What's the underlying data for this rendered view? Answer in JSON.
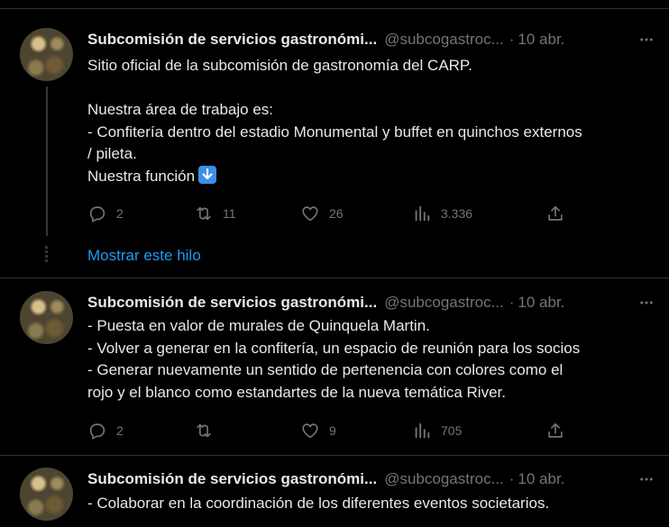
{
  "tweets": [
    {
      "author_name": "Subcomisión de servicios gastronómi...",
      "handle": "@subcogastroc...",
      "separator": "·",
      "time": "10 abr.",
      "lines": [
        "Sitio oficial de la subcomisión de gastronomía del CARP.",
        "",
        "Nuestra área de trabajo es:",
        "- Confitería dentro del estadio Monumental y buffet en quinchos externos",
        "/ pileta.",
        "Nuestra función"
      ],
      "emoji": "arrow-down-emoji",
      "replies": "2",
      "retweets": "11",
      "likes": "26",
      "views": "3.336"
    },
    {
      "author_name": "Subcomisión de servicios gastronómi...",
      "handle": "@subcogastroc...",
      "separator": "·",
      "time": "10 abr.",
      "lines": [
        "- Puesta en valor de murales de Quinquela Martin.",
        "- Volver a generar en la confitería, un espacio de reunión para los socios",
        "- Generar nuevamente un sentido de pertenencia con colores como el",
        "rojo y el blanco como estandartes de la nueva temática River."
      ],
      "replies": "2",
      "retweets": "",
      "likes": "9",
      "views": "705"
    },
    {
      "author_name": "Subcomisión de servicios gastronómi...",
      "handle": "@subcogastroc...",
      "separator": "·",
      "time": "10 abr.",
      "lines": [
        "- Colaborar en la coordinación de los diferentes eventos societarios."
      ]
    }
  ],
  "show_thread_label": "Mostrar este hilo",
  "colors": {
    "background": "#000000",
    "text": "#e7e9ea",
    "muted": "#71767b",
    "link": "#1d9bf0",
    "divider": "#2f3336"
  }
}
